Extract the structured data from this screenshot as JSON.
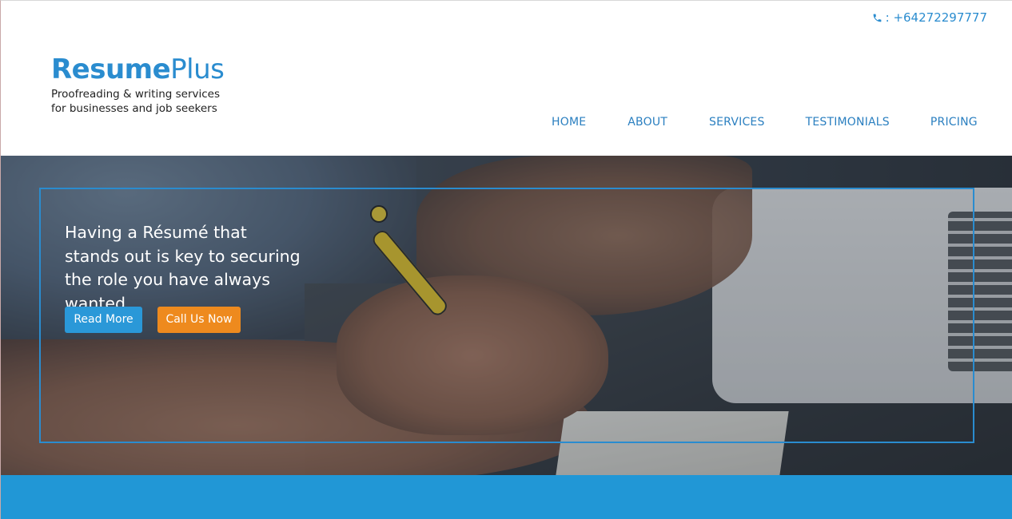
{
  "header": {
    "phone": ": +64272297777",
    "logo": {
      "bold": "Resume",
      "light": "Plus"
    },
    "tagline_line1": "Proofreading & writing services",
    "tagline_line2": "for businesses and job seekers",
    "nav": [
      "HOME",
      "ABOUT",
      "SERVICES",
      "TESTIMONIALS",
      "PRICING"
    ]
  },
  "hero": {
    "headline": "Having a Résumé that stands out is key to securing the role you have always wanted.",
    "read_more": "Read More",
    "call_us": "Call Us Now"
  },
  "colors": {
    "brand_blue": "#2a8ccf",
    "button_blue": "#2a98d8",
    "button_orange": "#ee8a1e",
    "band_blue": "#2197d6"
  },
  "icons": {
    "phone": "phone-icon"
  }
}
